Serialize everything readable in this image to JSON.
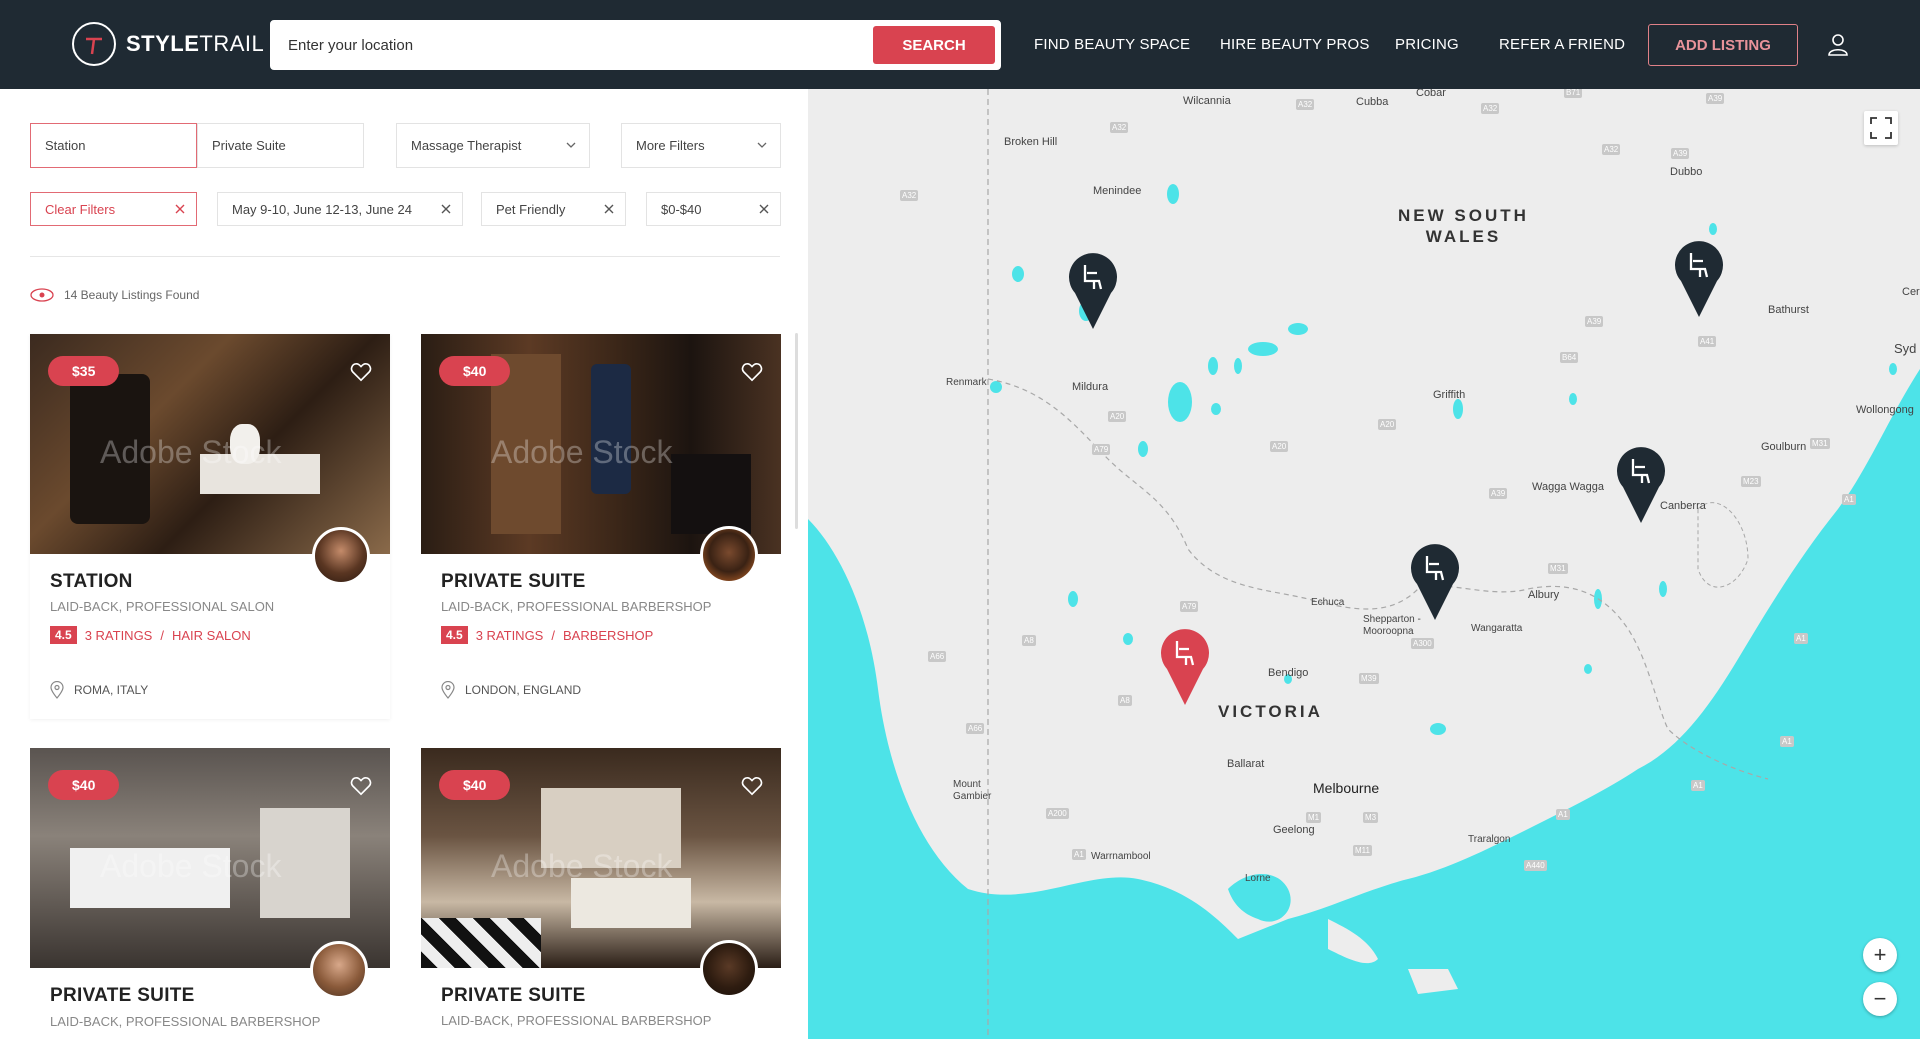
{
  "header": {
    "logo_text_bold": "STYLE",
    "logo_text_light": "TRAIL",
    "search_placeholder": "Enter your location",
    "search_button": "SEARCH",
    "nav": [
      "FIND BEAUTY SPACE",
      "HIRE BEAUTY PROS",
      "PRICING",
      "REFER A FRIEND"
    ],
    "add_listing": "ADD LISTING"
  },
  "filters": {
    "segments": [
      "Station",
      "Private Suite"
    ],
    "dropdowns": [
      "Massage Therapist",
      "More Filters"
    ],
    "chips": {
      "clear": "Clear Filters",
      "dates": "May 9-10, June 12-13, June 24",
      "pet": "Pet Friendly",
      "price": "$0-$40"
    }
  },
  "results_count": "14 Beauty Listings Found",
  "listings": [
    {
      "price": "$35",
      "title": "STATION",
      "subtitle": "LAID-BACK, PROFESSIONAL SALON",
      "rating": "4.5",
      "ratings_text": "3 RATINGS",
      "category": "HAIR SALON",
      "location": "ROMA, ITALY",
      "watermark": "Adobe Stock"
    },
    {
      "price": "$40",
      "title": "PRIVATE SUITE",
      "subtitle": "LAID-BACK, PROFESSIONAL BARBERSHOP",
      "rating": "4.5",
      "ratings_text": "3 RATINGS",
      "category": "BARBERSHOP",
      "location": "LONDON, ENGLAND",
      "watermark": "Adobe Stock"
    },
    {
      "price": "$40",
      "title": "PRIVATE SUITE",
      "subtitle": "LAID-BACK, PROFESSIONAL BARBERSHOP",
      "watermark": "Adobe Stock"
    },
    {
      "price": "$40",
      "title": "PRIVATE SUITE",
      "subtitle": "LAID-BACK, PROFESSIONAL BARBERSHOP",
      "watermark": "Adobe Stock"
    }
  ],
  "map": {
    "regions": {
      "nsw_line1": "NEW SOUTH",
      "nsw_line2": "WALES",
      "vic": "VICTORIA"
    },
    "towns": [
      "Wilcannia",
      "Cubba",
      "Cobar",
      "Broken Hill",
      "Menindee",
      "Dubbo",
      "Bathurst",
      "Cer",
      "Syd",
      "Renmark",
      "Mildura",
      "Griffith",
      "Wollongong",
      "Goulburn",
      "Wagga Wagga",
      "Canberra",
      "Echuca",
      "Albury",
      "Shepparton - Mooroopna",
      "Wangaratta",
      "Bendigo",
      "Mount Gambier",
      "Ballarat",
      "Melbourne",
      "Geelong",
      "Warrnambool",
      "Lorne",
      "Traralgon"
    ],
    "roads": [
      "A32",
      "A32",
      "A32",
      "A32",
      "A32",
      "A39",
      "A39",
      "B71",
      "A20",
      "A20",
      "A20",
      "A79",
      "A79",
      "A39",
      "A39",
      "B64",
      "A41",
      "M31",
      "M23",
      "M31",
      "A1",
      "A1",
      "A1",
      "A1",
      "A66",
      "A66",
      "A8",
      "A8",
      "M39",
      "A300",
      "A200",
      "A1",
      "M1",
      "M3",
      "M11",
      "A440",
      "A1"
    ],
    "zoom_in": "+",
    "zoom_out": "−"
  },
  "colors": {
    "accent": "#d94350",
    "header_bg": "#1f2a33",
    "water": "#4de3e8",
    "pin_dark": "#1f2a33"
  }
}
